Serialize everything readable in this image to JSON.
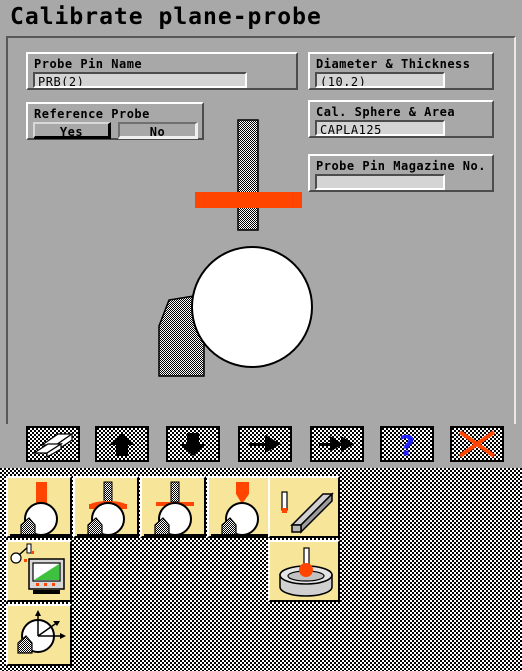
{
  "window": {
    "title": "Calibrate plane-probe"
  },
  "form": {
    "probe_pin_name": {
      "label": "Probe Pin Name",
      "value": "PRB(2)"
    },
    "reference_probe": {
      "label": "Reference Probe",
      "yes_label": "Yes",
      "no_label": "No",
      "selected": "Yes"
    },
    "diameter_thickness": {
      "label": "Diameter & Thickness",
      "value": "(10,2)"
    },
    "cal_sphere_area": {
      "label": "Cal. Sphere & Area",
      "value": "CAPLA125"
    },
    "probe_pin_magazine": {
      "label": "Probe Pin Magazine No.",
      "value": ""
    }
  },
  "diagram": {
    "name": "plane-probe-illustration",
    "shaft_fill": "dither-black-white",
    "plate_color": "#ff4500",
    "sphere_color": "#ffffff",
    "arm_fill": "dither-black-white"
  },
  "toolbar": {
    "buttons": [
      {
        "name": "plane-probe-icon",
        "icon": "two-blocks"
      },
      {
        "name": "arrow-up-icon",
        "icon": "arrow-up"
      },
      {
        "name": "arrow-down-icon",
        "icon": "arrow-down"
      },
      {
        "name": "arrow-right-icon",
        "icon": "arrow-right"
      },
      {
        "name": "arrow-double-right-icon",
        "icon": "arrow-double-right"
      },
      {
        "name": "help-question-icon",
        "icon": "question-mark"
      },
      {
        "name": "cancel-cross-icon",
        "icon": "red-cross"
      }
    ],
    "help_glyph": "?",
    "help_color": "#2020ff",
    "cancel_color": "#ff4500"
  },
  "palette": {
    "row1": [
      {
        "name": "probe-straight-stylus-icon"
      },
      {
        "name": "probe-disc-stylus-icon"
      },
      {
        "name": "probe-plane-stylus-icon"
      },
      {
        "name": "probe-cone-stylus-icon"
      },
      {
        "name": "gauge-block-icon"
      }
    ],
    "row2": [
      {
        "name": "monitor-display-icon"
      },
      {
        "name": "calibration-sphere-base-icon"
      }
    ],
    "row3": [
      {
        "name": "sphere-axes-icon"
      }
    ]
  },
  "colors": {
    "desktop": "#a8a8a8",
    "panel_face": "#a8a8a8",
    "field_face": "#d4d4d4",
    "accent_orange": "#ff4500",
    "palette_cell": "#f7e59a",
    "icon_gray": "#c8c8c8",
    "screen_green": "#3ec13e"
  }
}
